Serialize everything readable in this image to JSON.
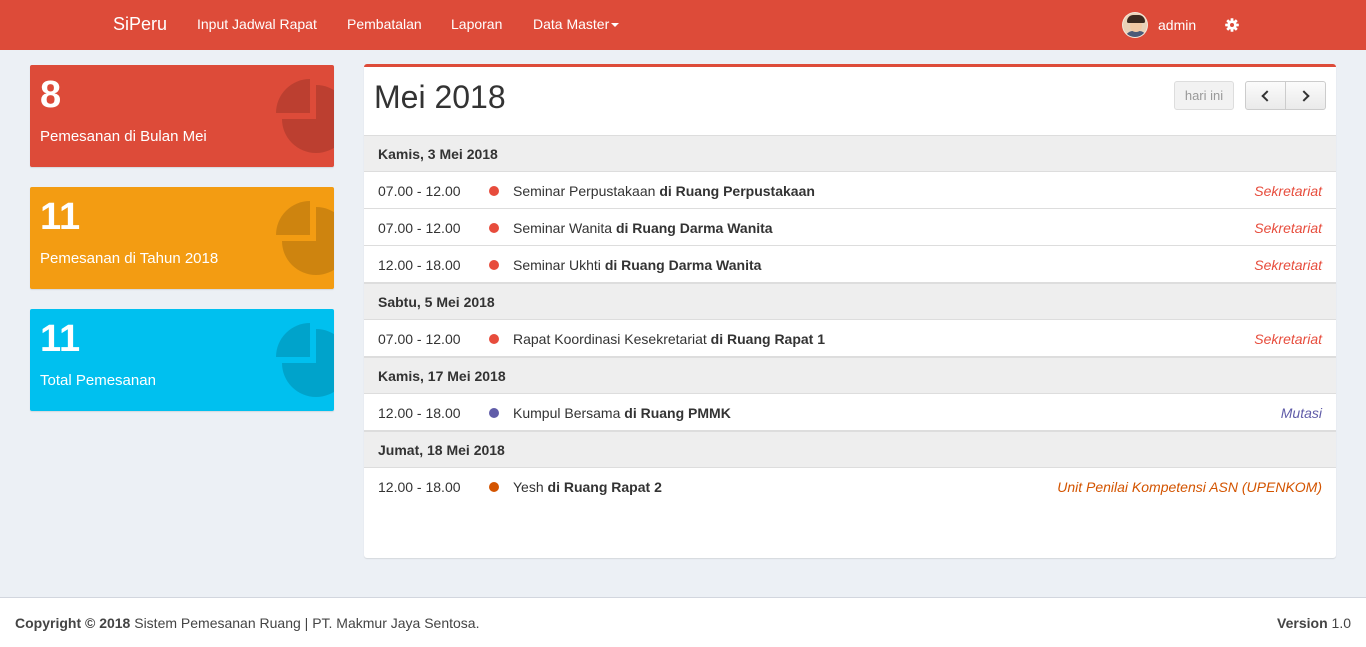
{
  "navbar": {
    "brand": "SiPeru",
    "items": [
      "Input Jadwal Rapat",
      "Pembatalan",
      "Laporan",
      "Data Master"
    ],
    "user_name": "admin"
  },
  "stats": [
    {
      "value": "8",
      "label": "Pemesanan di Bulan Mei",
      "color": "#dd4b39",
      "icon": "pie-chart-icon"
    },
    {
      "value": "11",
      "label": "Pemesanan di Tahun 2018",
      "color": "#f39c12",
      "icon": "pie-chart-icon"
    },
    {
      "value": "11",
      "label": "Total Pemesanan",
      "color": "#00c0ef",
      "icon": "pie-chart-icon"
    }
  ],
  "calendar": {
    "title": "Mei 2018",
    "today_label": "hari ini",
    "days": [
      {
        "label": "Kamis, 3 Mei 2018",
        "events": [
          {
            "time": "07.00 - 12.00",
            "title": "Seminar Perpustakaan",
            "room": "di Ruang Perpustakaan",
            "dept": "Sekretariat",
            "color": "#e74c3c"
          },
          {
            "time": "07.00 - 12.00",
            "title": "Seminar Wanita",
            "room": "di Ruang Darma Wanita",
            "dept": "Sekretariat",
            "color": "#e74c3c"
          },
          {
            "time": "12.00 - 18.00",
            "title": "Seminar Ukhti",
            "room": "di Ruang Darma Wanita",
            "dept": "Sekretariat",
            "color": "#e74c3c"
          }
        ]
      },
      {
        "label": "Sabtu, 5 Mei 2018",
        "events": [
          {
            "time": "07.00 - 12.00",
            "title": "Rapat Koordinasi Kesekretariat",
            "room": "di Ruang Rapat 1",
            "dept": "Sekretariat",
            "color": "#e74c3c"
          }
        ]
      },
      {
        "label": "Kamis, 17 Mei 2018",
        "events": [
          {
            "time": "12.00 - 18.00",
            "title": "Kumpul Bersama",
            "room": "di Ruang PMMK",
            "dept": "Mutasi",
            "color": "#605ca8"
          }
        ]
      },
      {
        "label": "Jumat, 18 Mei 2018",
        "events": [
          {
            "time": "12.00 - 18.00",
            "title": "Yesh",
            "room": "di Ruang Rapat 2",
            "dept": "Unit Penilai Kompetensi ASN (UPENKOM)",
            "color": "#d35400"
          }
        ]
      }
    ]
  },
  "footer": {
    "copyright_bold": "Copyright © 2018",
    "copyright_text": "Sistem Pemesanan Ruang | PT. Makmur Jaya Sentosa.",
    "version_label": "Version",
    "version_value": "1.0"
  }
}
